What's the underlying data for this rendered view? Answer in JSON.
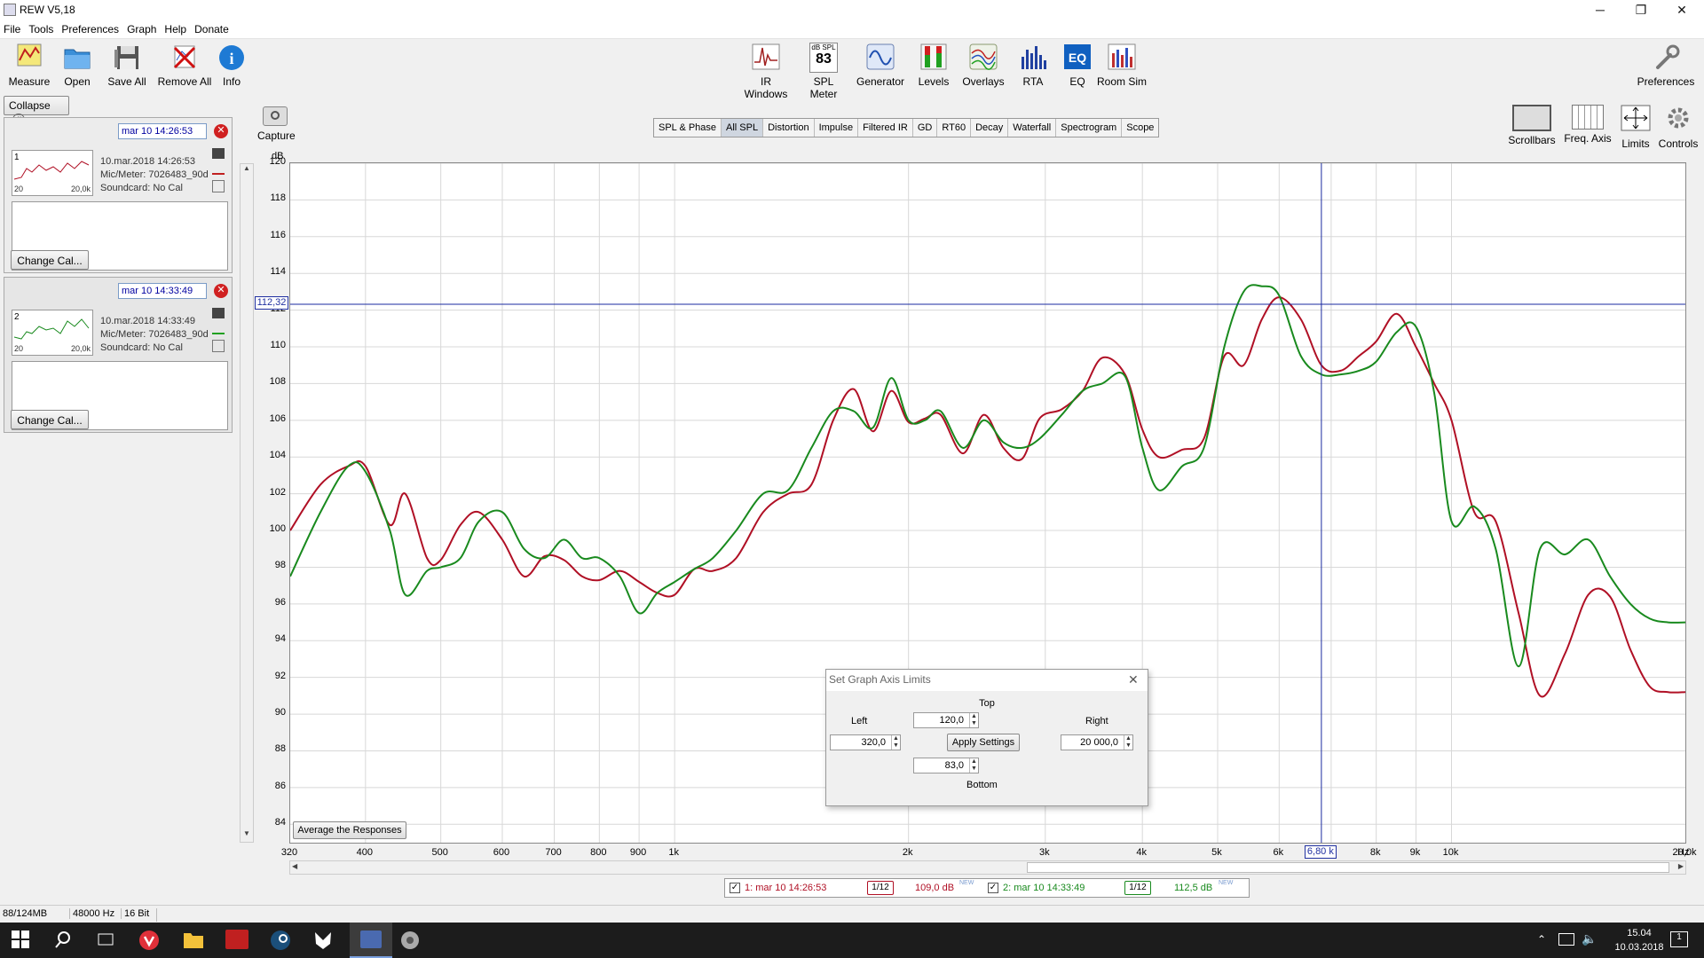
{
  "window": {
    "title": "REW V5,18",
    "minimize": "─",
    "maximize": "❐",
    "close": "✕"
  },
  "menu": [
    "File",
    "Tools",
    "Preferences",
    "Graph",
    "Help",
    "Donate"
  ],
  "toolbar": {
    "left": [
      {
        "label": "Measure",
        "icon": "measure-icon"
      },
      {
        "label": "Open",
        "icon": "folder-icon"
      },
      {
        "label": "Save All",
        "icon": "floppy-icon"
      },
      {
        "label": "Remove All",
        "icon": "remove-icon"
      },
      {
        "label": "Info",
        "icon": "info-icon"
      }
    ],
    "center": [
      {
        "label": "IR Windows",
        "icon": "ir-windows-icon"
      },
      {
        "label": "SPL Meter",
        "icon": "spl-meter-icon",
        "badge_top": "dB SPL",
        "badge_value": "83"
      },
      {
        "label": "Generator",
        "icon": "generator-icon"
      },
      {
        "label": "Levels",
        "icon": "levels-icon"
      },
      {
        "label": "Overlays",
        "icon": "overlays-icon"
      },
      {
        "label": "RTA",
        "icon": "rta-icon"
      },
      {
        "label": "EQ",
        "icon": "eq-icon"
      },
      {
        "label": "Room Sim",
        "icon": "room-sim-icon"
      }
    ],
    "preferences": "Preferences"
  },
  "sidebar": {
    "collapse": "Collapse",
    "collapse_icon": "«",
    "measurements": [
      {
        "title": "mar 10 14:26:53",
        "number": "1",
        "date": "10.mar.2018 14:26:53",
        "mic": "Mic/Meter: 7026483_90d",
        "soundcard": "Soundcard: No Cal",
        "thumb_left": "20",
        "thumb_right": "20,0k",
        "change_cal": "Change Cal...",
        "color": "#a01020"
      },
      {
        "title": "mar 10 14:33:49",
        "number": "2",
        "date": "10.mar.2018 14:33:49",
        "mic": "Mic/Meter: 7026483_90d",
        "soundcard": "Soundcard: No Cal",
        "thumb_left": "20",
        "thumb_right": "20,0k",
        "change_cal": "Change Cal...",
        "color": "#1a8020"
      }
    ]
  },
  "graph_tabs": [
    {
      "label": "SPL & Phase",
      "selected": false
    },
    {
      "label": "All SPL",
      "selected": true
    },
    {
      "label": "Distortion",
      "selected": false
    },
    {
      "label": "Impulse",
      "selected": false
    },
    {
      "label": "Filtered IR",
      "selected": false
    },
    {
      "label": "GD",
      "selected": false
    },
    {
      "label": "RT60",
      "selected": false
    },
    {
      "label": "Decay",
      "selected": false
    },
    {
      "label": "Waterfall",
      "selected": false
    },
    {
      "label": "Spectrogram",
      "selected": false
    },
    {
      "label": "Scope",
      "selected": false
    }
  ],
  "capture": "Capture",
  "right_tools": [
    {
      "label": "Scrollbars",
      "icon": "scrollbars-icon"
    },
    {
      "label": "Freq. Axis",
      "icon": "freq-axis-icon"
    },
    {
      "label": "Limits",
      "icon": "limits-icon"
    },
    {
      "label": "Controls",
      "icon": "gear-icon"
    }
  ],
  "average_button": "Average the Responses",
  "cursor": {
    "y_readout": "112,32",
    "x_readout": "6,80 k",
    "freq_hz": 6800,
    "spl_db": 112.32
  },
  "chart_data": {
    "type": "line",
    "ylabel": "dB",
    "xlabel": "Hz",
    "xscale": "log",
    "xlim": [
      320,
      20000
    ],
    "ylim": [
      83,
      120
    ],
    "y_ticks": [
      84,
      86,
      88,
      90,
      92,
      94,
      96,
      98,
      100,
      102,
      104,
      106,
      108,
      110,
      112,
      114,
      116,
      118,
      120
    ],
    "x_ticks": [
      {
        "v": 320,
        "t": "320"
      },
      {
        "v": 400,
        "t": "400"
      },
      {
        "v": 500,
        "t": "500"
      },
      {
        "v": 600,
        "t": "600"
      },
      {
        "v": 700,
        "t": "700"
      },
      {
        "v": 800,
        "t": "800"
      },
      {
        "v": 900,
        "t": "900"
      },
      {
        "v": 1000,
        "t": "1k"
      },
      {
        "v": 2000,
        "t": "2k"
      },
      {
        "v": 3000,
        "t": "3k"
      },
      {
        "v": 4000,
        "t": "4k"
      },
      {
        "v": 5000,
        "t": "5k"
      },
      {
        "v": 6000,
        "t": "6k"
      },
      {
        "v": 8000,
        "t": "8k"
      },
      {
        "v": 9000,
        "t": "9k"
      },
      {
        "v": 10000,
        "t": "10k"
      },
      {
        "v": 20000,
        "t": "20,0k"
      }
    ],
    "grid": true,
    "series": [
      {
        "name": "1: mar 10 14:26:53",
        "color": "#b01025",
        "x": [
          320,
          350,
          380,
          400,
          430,
          450,
          480,
          500,
          530,
          560,
          600,
          640,
          680,
          720,
          760,
          800,
          850,
          900,
          950,
          1000,
          1060,
          1120,
          1200,
          1300,
          1400,
          1500,
          1600,
          1700,
          1800,
          1900,
          2000,
          2100,
          2200,
          2350,
          2500,
          2650,
          2800,
          2950,
          3150,
          3350,
          3550,
          3800,
          4000,
          4200,
          4500,
          4800,
          5100,
          5400,
          5700,
          6000,
          6400,
          6800,
          7200,
          7600,
          8000,
          8500,
          9000,
          9500,
          10000,
          10700,
          11400,
          12200,
          13000,
          14000,
          15000,
          16000,
          17000,
          18000,
          19000,
          20000
        ],
        "y": [
          100,
          102.5,
          103.5,
          103.5,
          100.3,
          102,
          98.5,
          98.4,
          100.3,
          101,
          99.5,
          97.5,
          98.6,
          98.4,
          97.5,
          97.3,
          97.8,
          97.2,
          96.6,
          96.5,
          97.9,
          97.8,
          98.5,
          101,
          102,
          102.5,
          106,
          107.7,
          105.4,
          107.6,
          105.9,
          106.1,
          106.3,
          104.2,
          106.3,
          104.5,
          103.9,
          106.1,
          106.6,
          107.6,
          109.4,
          108.5,
          105.5,
          104,
          104.4,
          105,
          109.5,
          109,
          111.5,
          112.7,
          111.5,
          109,
          108.7,
          109.5,
          110.3,
          111.8,
          110,
          108,
          106,
          101,
          100.5,
          95.5,
          91,
          93.3,
          96.5,
          96.4,
          93.5,
          91.5,
          91.2,
          91.2
        ]
      },
      {
        "name": "2: mar 10 14:33:49",
        "color": "#198a1e",
        "x": [
          320,
          350,
          380,
          400,
          430,
          450,
          480,
          500,
          530,
          560,
          600,
          640,
          680,
          720,
          760,
          800,
          850,
          900,
          950,
          1000,
          1060,
          1120,
          1200,
          1300,
          1400,
          1500,
          1600,
          1700,
          1800,
          1900,
          2000,
          2100,
          2200,
          2350,
          2500,
          2650,
          2800,
          2950,
          3150,
          3350,
          3550,
          3800,
          4000,
          4200,
          4500,
          4800,
          5100,
          5400,
          5700,
          6000,
          6400,
          6800,
          7200,
          7600,
          8000,
          8500,
          9000,
          9500,
          10000,
          10700,
          11400,
          12200,
          13000,
          14000,
          15000,
          16000,
          17000,
          18000,
          19000,
          20000
        ],
        "y": [
          97.5,
          101,
          103.5,
          103.2,
          100,
          96.5,
          97.8,
          98,
          98.5,
          100.5,
          101,
          99,
          98.5,
          99.5,
          98.5,
          98.5,
          97.5,
          95.5,
          96.6,
          97.2,
          97.9,
          98.5,
          100,
          102,
          102.2,
          104.5,
          106.5,
          106.5,
          105.6,
          108.3,
          106,
          106,
          106.5,
          104.5,
          106,
          104.8,
          104.5,
          105,
          106.3,
          107.6,
          108,
          108.4,
          104.5,
          102.2,
          103.5,
          104.5,
          110,
          113,
          113.3,
          112.8,
          109.5,
          108.5,
          108.5,
          108.7,
          109.2,
          110.8,
          111.1,
          107.5,
          100.5,
          101.3,
          99,
          92.6,
          99,
          98.7,
          99.5,
          97.5,
          96,
          95.2,
          95,
          95
        ]
      }
    ]
  },
  "dialog": {
    "title": "Set Graph Axis Limits",
    "close": "✕",
    "top_label": "Top",
    "top_value": "120,0",
    "left_label": "Left",
    "left_value": "320,0",
    "right_label": "Right",
    "right_value": "20 000,0",
    "bottom_label": "Bottom",
    "bottom_value": "83,0",
    "apply": "Apply Settings"
  },
  "legend": [
    {
      "label": "1: mar 10 14:26:53",
      "smoothing": "1/12",
      "value": "109,0 dB",
      "tag": "NEW",
      "color": "#b01025"
    },
    {
      "label": "2: mar 10 14:33:49",
      "smoothing": "1/12",
      "value": "112,5 dB",
      "tag": "NEW",
      "color": "#198a1e"
    }
  ],
  "status": {
    "memory": "88/124MB",
    "rate": "48000 Hz",
    "bits": "16 Bit"
  },
  "taskbar": {
    "time": "15.04",
    "date": "10.03.2018",
    "notif_count": "1"
  }
}
